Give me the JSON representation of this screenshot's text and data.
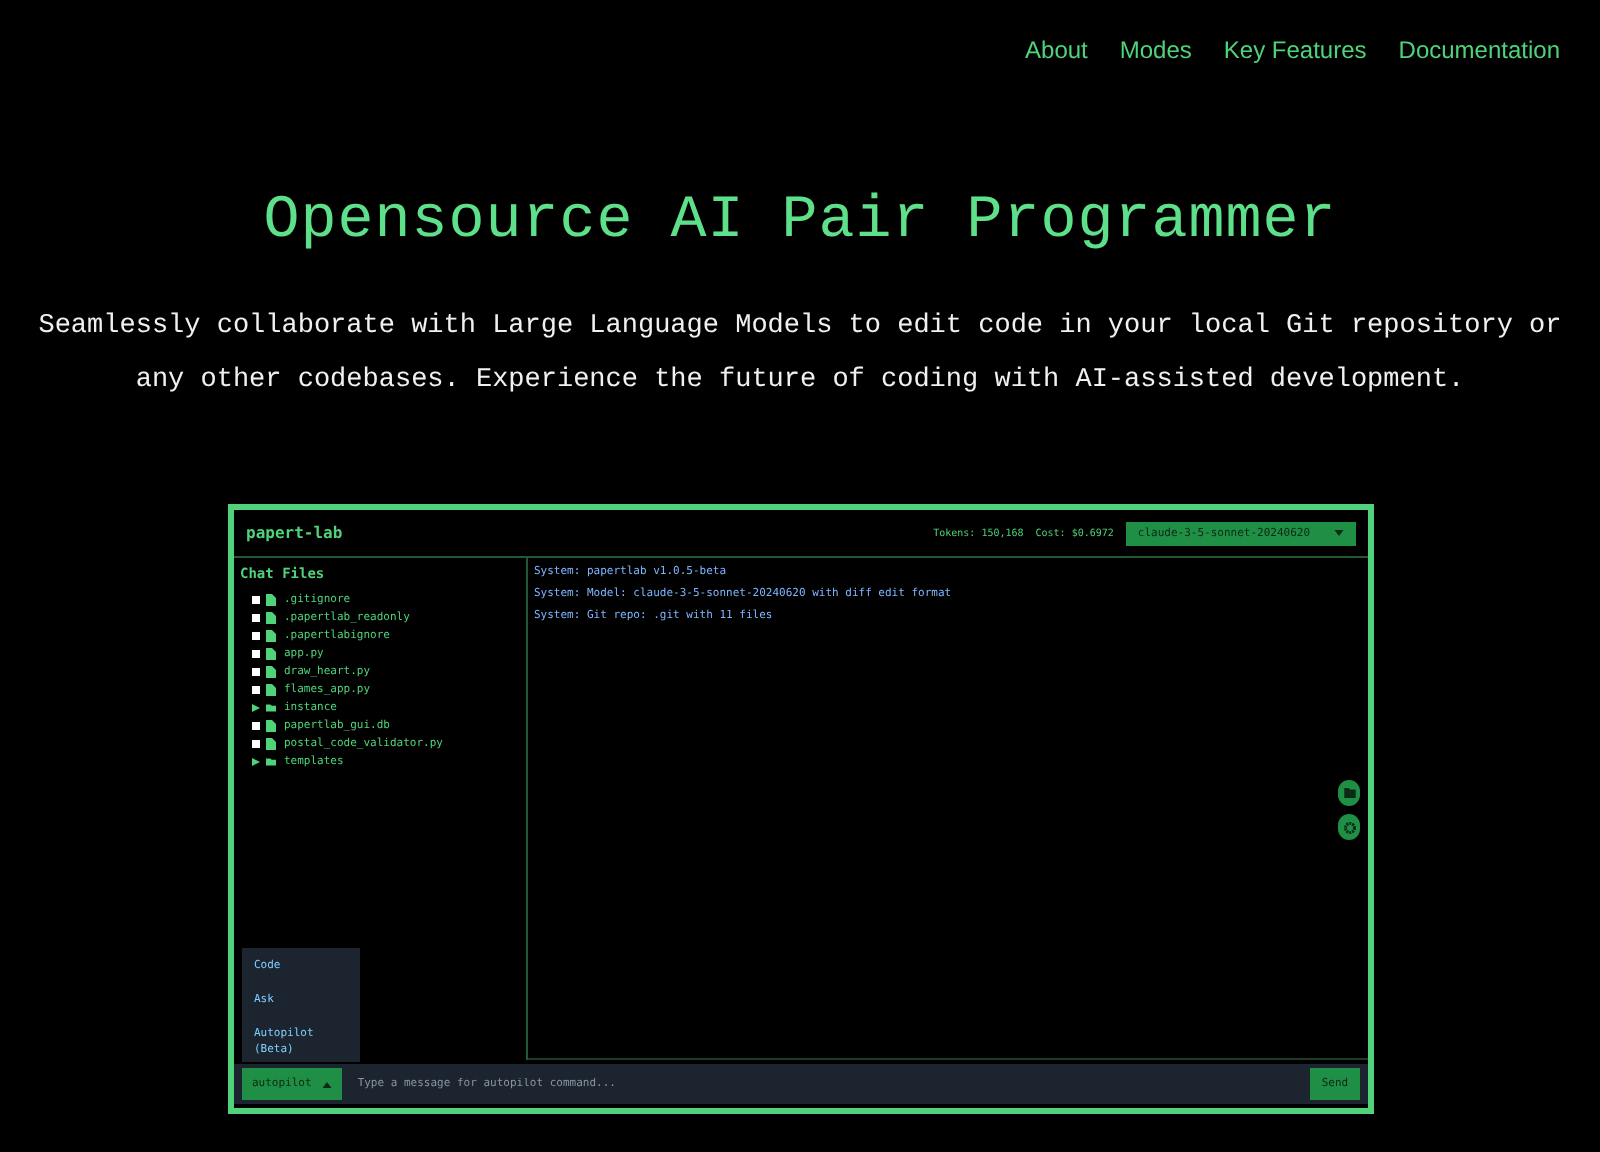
{
  "nav": [
    {
      "label": "About"
    },
    {
      "label": "Modes"
    },
    {
      "label": "Key Features"
    },
    {
      "label": "Documentation"
    }
  ],
  "hero": {
    "title": "Opensource AI Pair Programmer",
    "subtitle": "Seamlessly collaborate with Large Language Models to edit code in your local Git repository or any other codebases. Experience the future of coding with AI-assisted development."
  },
  "app": {
    "title": "papert-lab",
    "tokens": "Tokens: 150,168",
    "cost": "Cost: $0.6972",
    "model": "claude-3-5-sonnet-20240620",
    "sidebar": {
      "heading": "Chat Files",
      "items": [
        {
          "kind": "file",
          "name": ".gitignore",
          "checked": false
        },
        {
          "kind": "file",
          "name": ".papertlab_readonly",
          "checked": false
        },
        {
          "kind": "file",
          "name": ".papertlabignore",
          "checked": false
        },
        {
          "kind": "file",
          "name": "app.py",
          "checked": false
        },
        {
          "kind": "file",
          "name": "draw_heart.py",
          "checked": false
        },
        {
          "kind": "file",
          "name": "flames_app.py",
          "checked": false
        },
        {
          "kind": "folder",
          "name": "instance",
          "expanded": false
        },
        {
          "kind": "file",
          "name": "papertlab_gui.db",
          "checked": false
        },
        {
          "kind": "file",
          "name": "postal_code_validator.py",
          "checked": false
        },
        {
          "kind": "folder",
          "name": "templates",
          "expanded": false
        }
      ]
    },
    "messages": [
      {
        "sender": "System:",
        "text": "papertlab v1.0.5-beta"
      },
      {
        "sender": "System:",
        "text": "Model: claude-3-5-sonnet-20240620 with diff edit format"
      },
      {
        "sender": "System:",
        "text": "Git repo: .git with 11 files"
      }
    ],
    "mode_menu": {
      "expanded": true,
      "items": [
        {
          "label": "Code",
          "selected": false
        },
        {
          "label": "Ask",
          "selected": false
        },
        {
          "label": "Autopilot (Beta)",
          "selected": false
        }
      ]
    },
    "mode_button": "autopilot",
    "input": {
      "placeholder": "Type a message for autopilot command..."
    },
    "send": "Send"
  }
}
